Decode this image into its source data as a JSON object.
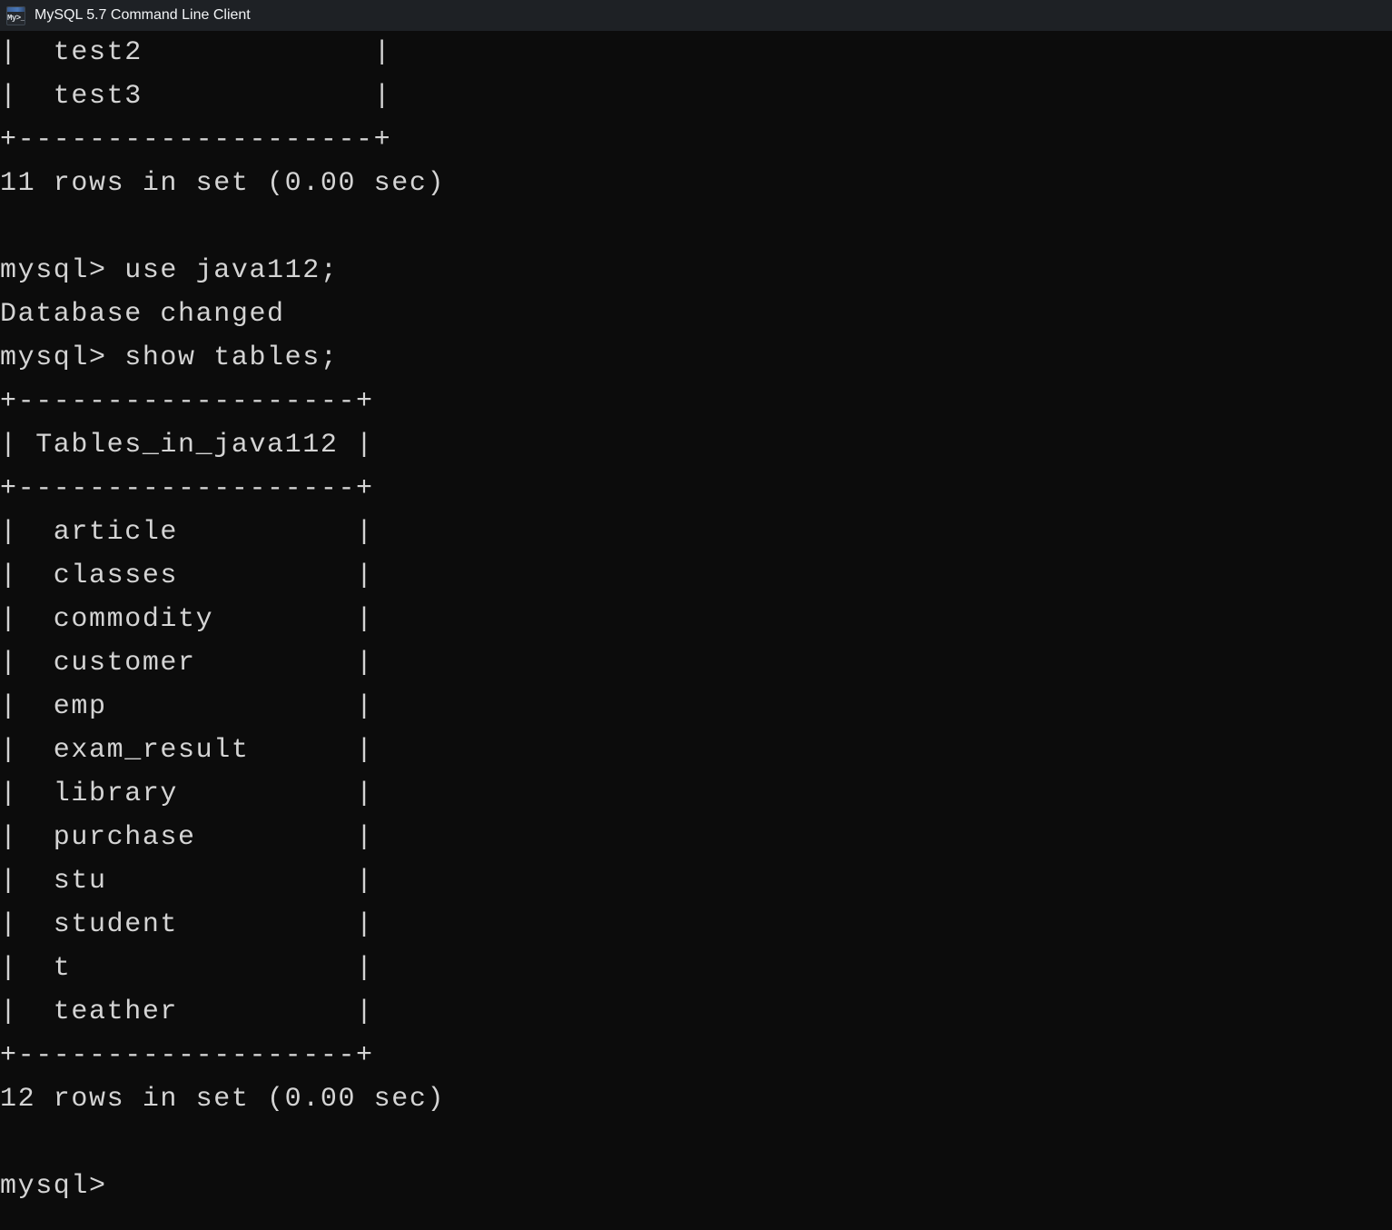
{
  "window": {
    "title": "MySQL 5.7 Command Line Client",
    "icon_name": "mysql-console-icon",
    "icon_glyph": "My&gt;_",
    "titlebar_color": "#1e2125",
    "terminal_bg": "#0c0c0c",
    "terminal_fg": "#d4d4d4"
  },
  "terminal": {
    "previous_result": {
      "visible_rows": [
        "test2",
        "test3"
      ],
      "separator": "+--------------------+",
      "status": "11 rows in set (0.00 sec)"
    },
    "commands": [
      {
        "prompt": "mysql>",
        "text": " use java112;"
      },
      {
        "prompt": "",
        "text": "Database changed"
      },
      {
        "prompt": "mysql>",
        "text": " show tables;"
      }
    ],
    "result_table": {
      "separator": "+-------------------+",
      "header": "| Tables_in_java112 |",
      "rows": [
        "article",
        "classes",
        "commodity",
        "customer",
        "emp",
        "exam_result",
        "library",
        "purchase",
        "stu",
        "student",
        "t",
        "teather"
      ],
      "status": "12 rows in set (0.00 sec)"
    },
    "final_prompt": "mysql>",
    "lines": [
      "|  test2             |",
      "|  test3             |",
      "+--------------------+",
      "11 rows in set (0.00 sec)",
      "",
      "mysql> use java112;",
      "Database changed",
      "mysql> show tables;",
      "+-------------------+",
      "| Tables_in_java112 |",
      "+-------------------+",
      "|  article          |",
      "|  classes          |",
      "|  commodity        |",
      "|  customer         |",
      "|  emp              |",
      "|  exam_result      |",
      "|  library          |",
      "|  purchase         |",
      "|  stu              |",
      "|  student          |",
      "|  t                |",
      "|  teather          |",
      "+-------------------+",
      "12 rows in set (0.00 sec)",
      "",
      "mysql>"
    ]
  }
}
